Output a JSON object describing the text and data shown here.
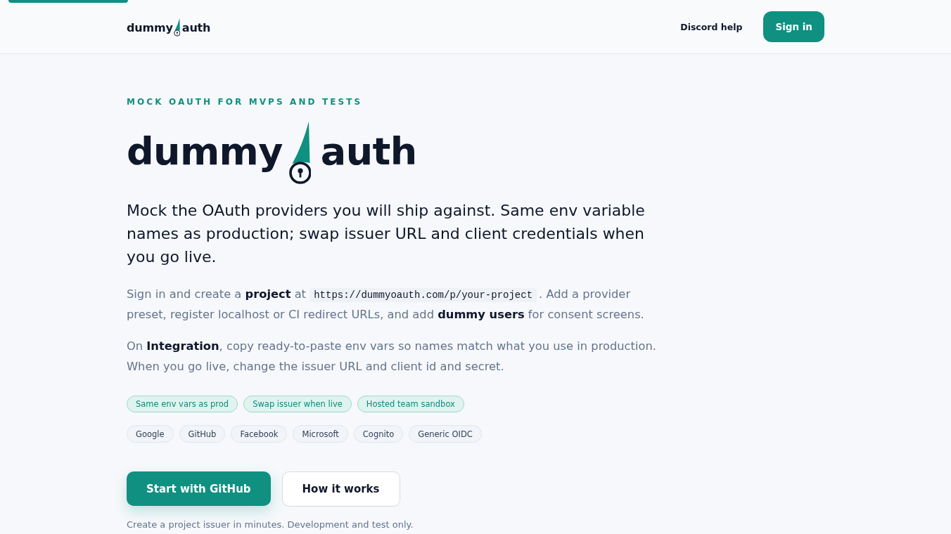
{
  "header": {
    "logo": {
      "left": "dummy",
      "right": "auth"
    },
    "nav": [
      {
        "kind": "link",
        "label": "Discord help"
      },
      {
        "kind": "button",
        "label": "Sign in"
      }
    ]
  },
  "hero": {
    "eyebrow": "MOCK OAUTH FOR MVPS AND TESTS",
    "logo": {
      "left": "dummy",
      "right": "auth"
    },
    "headline": "Mock the OAuth providers you will ship against. Same env variable names as production; swap issuer URL and client credentials when you go live.",
    "paragraphs": [
      [
        {
          "kind": "text",
          "text": "Sign in and create a **project** at "
        },
        {
          "kind": "code",
          "text": "https://dummyoauth.com/p/your-project"
        },
        {
          "kind": "text",
          "text": ". Add a provider preset, register localhost or CI redirect URLs, and add **dummy users** for consent screens."
        }
      ],
      [
        {
          "kind": "text",
          "text": "On **Integration**, copy ready-to-paste env vars so names match what you use in production. When you go live, change the issuer URL and client id and secret."
        }
      ]
    ],
    "highlights": [
      "Same env vars as prod",
      "Swap issuer when live",
      "Hosted team sandbox"
    ],
    "providers": [
      "Google",
      "GitHub",
      "Facebook",
      "Microsoft",
      "Cognito",
      "Generic OIDC"
    ],
    "actions": [
      {
        "kind": "primary",
        "label": "Start with GitHub"
      },
      {
        "kind": "secondary",
        "label": "How it works"
      }
    ],
    "note": "Create a project issuer in minutes. Development and test only."
  }
}
